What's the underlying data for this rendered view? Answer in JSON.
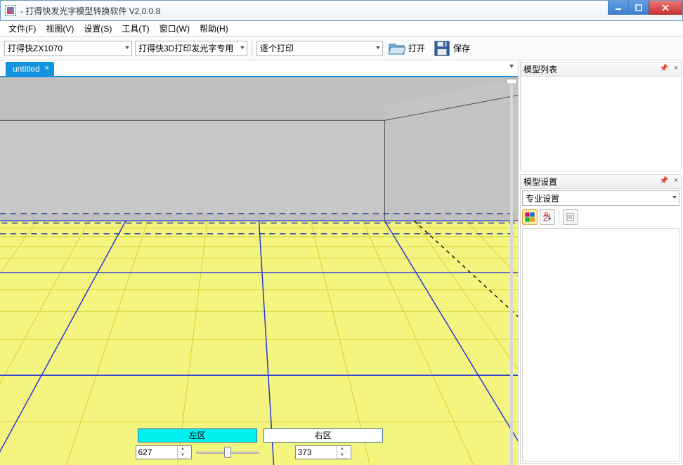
{
  "window": {
    "title": " - 打得快发光字模型转换软件 V2.0.0.8"
  },
  "menu": {
    "file": "文件(F)",
    "view": "视图(V)",
    "settings": "设置(S)",
    "tools": "工具(T)",
    "window": "窗口(W)",
    "help": "帮助(H)"
  },
  "toolbar": {
    "printer_model": "打得快ZX1070",
    "model_mode": "打得快3D打印发光字专用",
    "print_mode": "逐个打印",
    "open_label": "打开",
    "save_label": "保存"
  },
  "tabs": {
    "active": "untitled"
  },
  "bottom": {
    "left_zone": "左区",
    "right_zone": "右区",
    "left_value": "627",
    "right_value": "373"
  },
  "panels": {
    "model_list_title": "模型列表",
    "model_settings_title": "模型设置",
    "settings_dropdown": "专业设置"
  }
}
